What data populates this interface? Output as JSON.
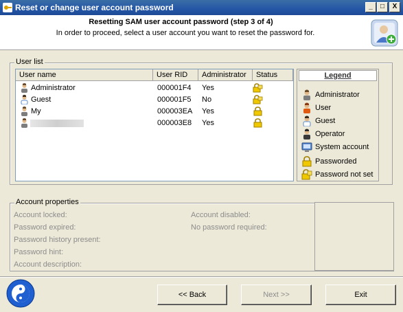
{
  "window": {
    "title": "Reset or change user account password",
    "controls": {
      "minimize": "_",
      "maximize": "□",
      "close": "X"
    }
  },
  "header": {
    "title": "Resetting SAM user account password (step 3 of 4)",
    "subtitle": "In order to proceed, select a user account you want to reset the password for.",
    "icon": "user-card-add-icon"
  },
  "user_list": {
    "group_label": "User list",
    "columns": [
      "User name",
      "User RID",
      "Administrator",
      "Status"
    ],
    "rows": [
      {
        "name": "Administrator",
        "rid": "000001F4",
        "admin": "Yes",
        "icon": "administrator-icon",
        "status_icon": "password-not-set-icon"
      },
      {
        "name": "Guest",
        "rid": "000001F5",
        "admin": "No",
        "icon": "guest-icon",
        "status_icon": "password-not-set-icon"
      },
      {
        "name": "My",
        "rid": "000003EA",
        "admin": "Yes",
        "icon": "administrator-icon",
        "status_icon": "passworded-icon"
      },
      {
        "name": "",
        "rid": "000003E8",
        "admin": "Yes",
        "icon": "administrator-icon",
        "status_icon": "passworded-icon"
      }
    ]
  },
  "legend": {
    "title": "Legend",
    "items": [
      {
        "label": "Administrator",
        "icon": "administrator-icon"
      },
      {
        "label": "User",
        "icon": "user-icon"
      },
      {
        "label": "Guest",
        "icon": "guest-icon"
      },
      {
        "label": "Operator",
        "icon": "operator-icon"
      },
      {
        "label": "System account",
        "icon": "system-account-icon"
      },
      {
        "label": "Passworded",
        "icon": "passworded-icon"
      },
      {
        "label": "Password not set",
        "icon": "password-not-set-icon"
      }
    ]
  },
  "account_properties": {
    "group_label": "Account properties",
    "left": [
      "Account locked:",
      "Password expired:",
      "Password history present:",
      "Password hint:",
      "Account description:"
    ],
    "right": [
      "Account disabled:",
      "No password required:"
    ]
  },
  "buttons": {
    "back": "<< Back",
    "next": "Next >>",
    "exit": "Exit"
  },
  "colors": {
    "titlebar": "#2456a6",
    "disabled_text": "#8c8c8c",
    "lock": "#e0b800"
  }
}
